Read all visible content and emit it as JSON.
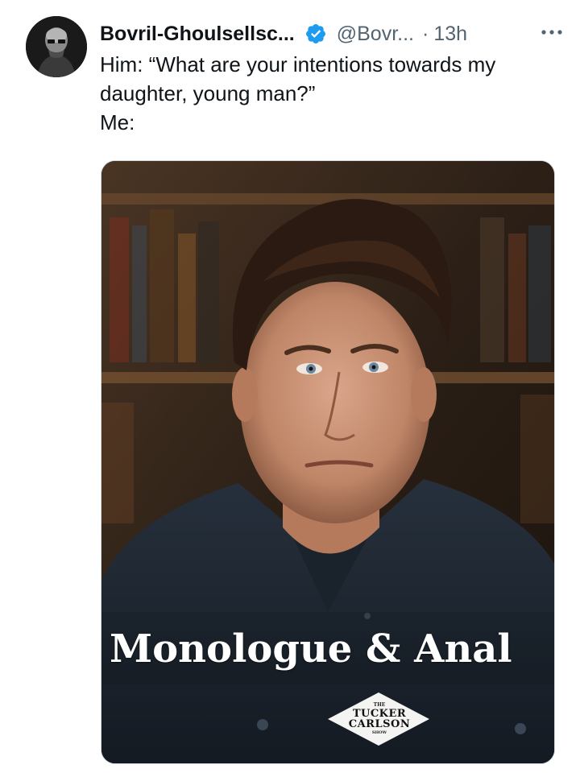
{
  "tweet": {
    "author": {
      "display_name": "Bovril-Ghoulsellsc...",
      "handle": "@Bovr...",
      "verified": true,
      "avatar_icon": "profile-avatar"
    },
    "separator": "·",
    "timestamp": "13h",
    "more_icon": "more-horizontal-icon",
    "text": "Him: “What are your intentions towards my daughter, young man?”\nMe:",
    "media": {
      "caption": "Monologue & Anal",
      "logo": {
        "top": "THE",
        "line1": "TUCKER",
        "line2": "CARLSON",
        "bottom": "SHOW"
      }
    }
  },
  "colors": {
    "text_primary": "#0f1419",
    "text_secondary": "#536471",
    "verified_blue": "#1d9bf0",
    "media_border": "#cfd9de"
  }
}
